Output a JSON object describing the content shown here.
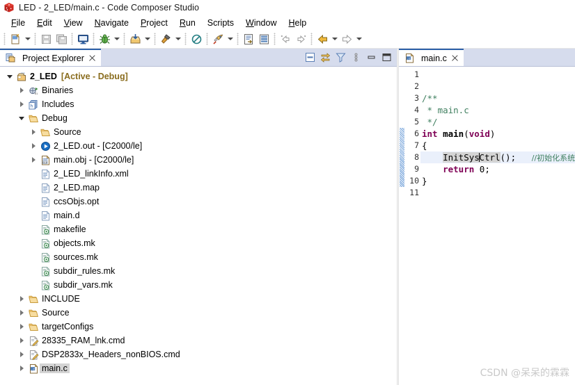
{
  "window": {
    "title": "LED - 2_LED/main.c - Code Composer Studio",
    "app_icon": "ccs-cube-icon",
    "accent_color": "#2b5fa8",
    "tabbar_color": "#d6dced"
  },
  "menubar": {
    "items": [
      {
        "label": "File",
        "mnemonic": "F"
      },
      {
        "label": "Edit",
        "mnemonic": "E"
      },
      {
        "label": "View",
        "mnemonic": "V"
      },
      {
        "label": "Navigate",
        "mnemonic": "N"
      },
      {
        "label": "Project",
        "mnemonic": "P"
      },
      {
        "label": "Run",
        "mnemonic": "R"
      },
      {
        "label": "Scripts",
        "mnemonic": ""
      },
      {
        "label": "Window",
        "mnemonic": "W"
      },
      {
        "label": "Help",
        "mnemonic": "H"
      }
    ]
  },
  "toolbar": {
    "groups": [
      {
        "buttons": [
          {
            "icon": "new-file-icon",
            "dropdown": true
          }
        ]
      },
      {
        "buttons": [
          {
            "icon": "save-icon",
            "dropdown": false
          },
          {
            "icon": "save-all-icon",
            "dropdown": false
          }
        ]
      },
      {
        "buttons": [
          {
            "icon": "console-icon",
            "dropdown": false
          }
        ]
      },
      {
        "buttons": [
          {
            "icon": "debug-bug-icon",
            "dropdown": true
          }
        ]
      },
      {
        "buttons": [
          {
            "icon": "load-program-icon",
            "dropdown": true
          }
        ]
      },
      {
        "buttons": [
          {
            "icon": "build-hammer-icon",
            "dropdown": true
          }
        ]
      },
      {
        "buttons": [
          {
            "icon": "no-build-icon",
            "dropdown": false
          }
        ]
      },
      {
        "buttons": [
          {
            "icon": "run-rocket-icon",
            "dropdown": true
          }
        ]
      },
      {
        "buttons": [
          {
            "icon": "open-declaration-icon",
            "dropdown": false
          },
          {
            "icon": "outline-icon",
            "dropdown": false
          }
        ]
      },
      {
        "buttons": [
          {
            "icon": "prev-annotation-icon",
            "dropdown": false
          },
          {
            "icon": "next-annotation-icon",
            "dropdown": false
          }
        ]
      },
      {
        "buttons": [
          {
            "icon": "back-arrow-icon",
            "dropdown": true
          },
          {
            "icon": "forward-arrow-icon",
            "dropdown": true
          }
        ]
      }
    ]
  },
  "project_explorer": {
    "tab_label": "Project Explorer",
    "tab_icon": "project-explorer-icon",
    "close_icon": "close-icon",
    "actions": [
      {
        "name": "collapse-all-icon"
      },
      {
        "name": "link-with-editor-icon"
      },
      {
        "name": "view-filter-icon"
      },
      {
        "name": "view-menu-icon"
      },
      {
        "name": "minimize-view-icon"
      },
      {
        "name": "maximize-view-icon"
      }
    ],
    "tree": [
      {
        "label": "2_LED",
        "suffix": "[Active - Debug]",
        "icon": "ccs-project-icon",
        "twist": "expanded",
        "indent": 0,
        "bold": true,
        "selected": false
      },
      {
        "label": "Binaries",
        "suffix": "",
        "icon": "binaries-icon",
        "twist": "collapsed",
        "indent": 1,
        "bold": false,
        "selected": false
      },
      {
        "label": "Includes",
        "suffix": "",
        "icon": "includes-icon",
        "twist": "collapsed",
        "indent": 1,
        "bold": false,
        "selected": false
      },
      {
        "label": "Debug",
        "suffix": "",
        "icon": "folder-icon",
        "twist": "expanded",
        "indent": 1,
        "bold": false,
        "selected": false
      },
      {
        "label": "Source",
        "suffix": "",
        "icon": "folder-icon",
        "twist": "collapsed",
        "indent": 2,
        "bold": false,
        "selected": false
      },
      {
        "label": "2_LED.out - [C2000/le]",
        "suffix": "",
        "icon": "executable-icon",
        "twist": "collapsed",
        "indent": 2,
        "bold": false,
        "selected": false
      },
      {
        "label": "main.obj - [C2000/le]",
        "suffix": "",
        "icon": "object-file-icon",
        "twist": "collapsed",
        "indent": 2,
        "bold": false,
        "selected": false
      },
      {
        "label": "2_LED_linkInfo.xml",
        "suffix": "",
        "icon": "xml-file-icon",
        "twist": "none",
        "indent": 2,
        "bold": false,
        "selected": false
      },
      {
        "label": "2_LED.map",
        "suffix": "",
        "icon": "text-file-icon",
        "twist": "none",
        "indent": 2,
        "bold": false,
        "selected": false
      },
      {
        "label": "ccsObjs.opt",
        "suffix": "",
        "icon": "text-file-icon",
        "twist": "none",
        "indent": 2,
        "bold": false,
        "selected": false
      },
      {
        "label": "main.d",
        "suffix": "",
        "icon": "text-file-icon",
        "twist": "none",
        "indent": 2,
        "bold": false,
        "selected": false
      },
      {
        "label": "makefile",
        "suffix": "",
        "icon": "makefile-icon",
        "twist": "none",
        "indent": 2,
        "bold": false,
        "selected": false
      },
      {
        "label": "objects.mk",
        "suffix": "",
        "icon": "makefile-icon",
        "twist": "none",
        "indent": 2,
        "bold": false,
        "selected": false
      },
      {
        "label": "sources.mk",
        "suffix": "",
        "icon": "makefile-icon",
        "twist": "none",
        "indent": 2,
        "bold": false,
        "selected": false
      },
      {
        "label": "subdir_rules.mk",
        "suffix": "",
        "icon": "makefile-icon",
        "twist": "none",
        "indent": 2,
        "bold": false,
        "selected": false
      },
      {
        "label": "subdir_vars.mk",
        "suffix": "",
        "icon": "makefile-icon",
        "twist": "none",
        "indent": 2,
        "bold": false,
        "selected": false
      },
      {
        "label": "INCLUDE",
        "suffix": "",
        "icon": "folder-icon",
        "twist": "collapsed",
        "indent": 1,
        "bold": false,
        "selected": false
      },
      {
        "label": "Source",
        "suffix": "",
        "icon": "folder-icon",
        "twist": "collapsed",
        "indent": 1,
        "bold": false,
        "selected": false
      },
      {
        "label": "targetConfigs",
        "suffix": "",
        "icon": "folder-icon",
        "twist": "collapsed",
        "indent": 1,
        "bold": false,
        "selected": false
      },
      {
        "label": "28335_RAM_lnk.cmd",
        "suffix": "",
        "icon": "cmd-file-icon",
        "twist": "collapsed",
        "indent": 1,
        "bold": false,
        "selected": false
      },
      {
        "label": "DSP2833x_Headers_nonBIOS.cmd",
        "suffix": "",
        "icon": "cmd-file-icon",
        "twist": "collapsed",
        "indent": 1,
        "bold": false,
        "selected": false
      },
      {
        "label": "main.c",
        "suffix": "",
        "icon": "c-file-icon",
        "twist": "collapsed",
        "indent": 1,
        "bold": false,
        "selected": true
      }
    ]
  },
  "editor": {
    "tab_label": "main.c",
    "tab_icon": "c-file-icon",
    "close_icon": "close-icon",
    "line_numbers": [
      "1",
      "2",
      "3",
      "4",
      "5",
      "6",
      "7",
      "8",
      "9",
      "10",
      "11"
    ],
    "change_marker_lines": [
      6,
      7,
      8,
      9,
      10
    ],
    "highlight_line": 8,
    "lines": [
      {
        "n": 1,
        "segments": []
      },
      {
        "n": 2,
        "segments": []
      },
      {
        "n": 3,
        "segments": [
          {
            "text": "/**",
            "style": "cmt"
          }
        ]
      },
      {
        "n": 4,
        "segments": [
          {
            "text": " * main.c",
            "style": "cmt"
          }
        ]
      },
      {
        "n": 5,
        "segments": [
          {
            "text": " */",
            "style": "cmt"
          }
        ]
      },
      {
        "n": 6,
        "segments": [
          {
            "text": "int",
            "style": "kw"
          },
          {
            "text": " ",
            "style": "plain"
          },
          {
            "text": "main",
            "style": "fn"
          },
          {
            "text": "(",
            "style": "plain"
          },
          {
            "text": "void",
            "style": "kw"
          },
          {
            "text": ")",
            "style": "plain"
          }
        ]
      },
      {
        "n": 7,
        "segments": [
          {
            "text": "{",
            "style": "plain"
          }
        ]
      },
      {
        "n": 8,
        "segments": [
          {
            "text": "    ",
            "style": "plain"
          },
          {
            "text": "InitSysCtrl",
            "style": "occ"
          },
          {
            "text": "();",
            "style": "plain"
          },
          {
            "text": "   ",
            "style": "plain"
          },
          {
            "text": "//初始化系统时钟",
            "style": "cmt-cn"
          }
        ]
      },
      {
        "n": 9,
        "segments": [
          {
            "text": "    ",
            "style": "plain"
          },
          {
            "text": "return",
            "style": "kw"
          },
          {
            "text": " 0;",
            "style": "plain"
          }
        ]
      },
      {
        "n": 10,
        "segments": [
          {
            "text": "}",
            "style": "plain"
          }
        ]
      },
      {
        "n": 11,
        "segments": []
      }
    ],
    "caret_line": 8,
    "caret_after_text": "InitSys"
  },
  "watermark": {
    "text": "CSDN @呆呆的霖霖"
  }
}
